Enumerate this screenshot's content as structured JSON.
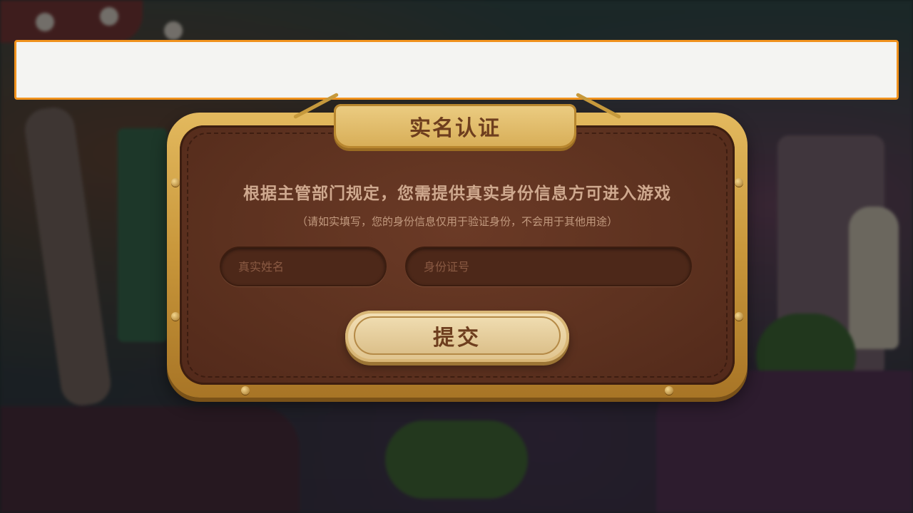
{
  "top_bar": {
    "border_color": "#f0921e",
    "fill_color": "#f4f4f2"
  },
  "dialog": {
    "title": "实名认证",
    "message": "根据主管部门规定，您需提供真实身份信息方可进入游戏",
    "note": "（请如实填写，您的身份信息仅用于验证身份，不会用于其他用途）",
    "name_field": {
      "placeholder": "真实姓名",
      "value": ""
    },
    "id_field": {
      "placeholder": "身份证号",
      "value": ""
    },
    "submit_label": "提交",
    "colors": {
      "frame_gold": "#d2a24a",
      "panel_brown": "#5c311f",
      "title_text": "#6e3e1e",
      "body_text": "#cfa98f"
    }
  }
}
